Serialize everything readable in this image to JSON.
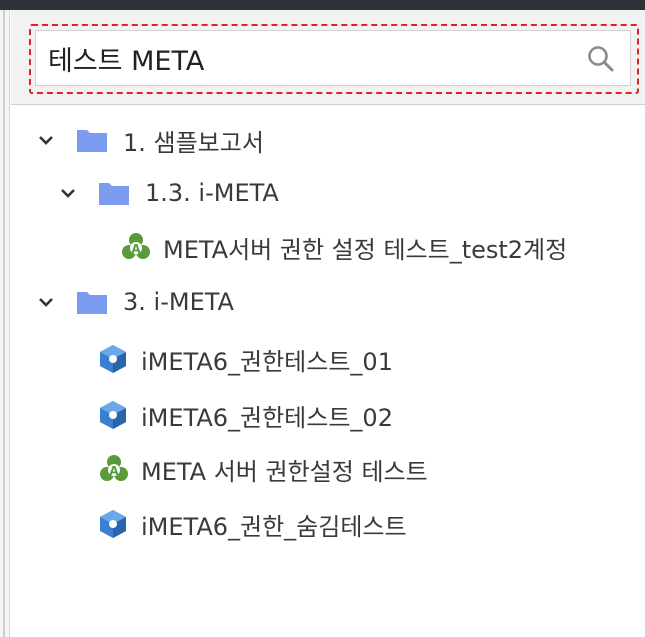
{
  "search": {
    "value": "테스트 META",
    "placeholder": ""
  },
  "colors": {
    "folder": "#7b9cf0",
    "highlight": "#e52020",
    "report_icon": "#5a9a3a",
    "cube_icon": "#3a7fd0"
  },
  "tree": [
    {
      "label": "1. 샘플보고서",
      "icon": "folder-icon",
      "expanded": true
    },
    {
      "label": "1.3. i-META",
      "icon": "folder-icon",
      "expanded": true
    },
    {
      "label": "META서버 권한 설정 테스트_test2계정",
      "icon": "report-icon"
    },
    {
      "label": "3. i-META",
      "icon": "folder-icon",
      "expanded": true
    },
    {
      "label": "iMETA6_권한테스트_01",
      "icon": "cube-icon"
    },
    {
      "label": "iMETA6_권한테스트_02",
      "icon": "cube-icon"
    },
    {
      "label": "META 서버 권한설정 테스트",
      "icon": "report-icon"
    },
    {
      "label": "iMETA6_권한_숨김테스트",
      "icon": "cube-icon"
    }
  ]
}
